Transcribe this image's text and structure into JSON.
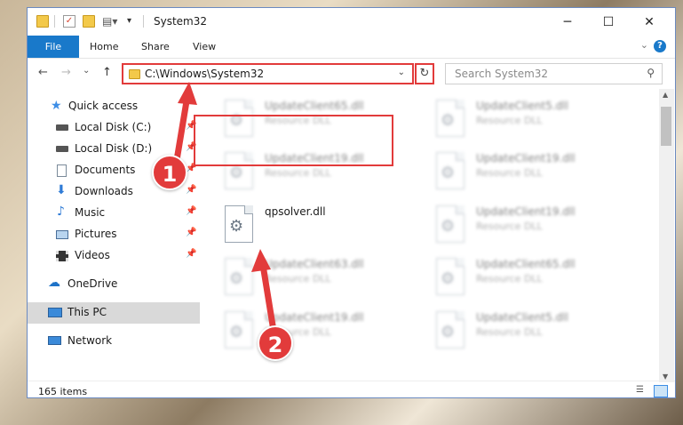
{
  "window": {
    "title": "System32",
    "controls": {
      "minimize": "─",
      "maximize": "☐",
      "close": "✕"
    }
  },
  "ribbon": {
    "tabs": [
      "File",
      "Home",
      "Share",
      "View"
    ],
    "help": "?"
  },
  "navbar": {
    "back": "←",
    "forward": "→",
    "dropdown": "⌄",
    "up": "↑",
    "address": "C:\\Windows\\System32",
    "address_dropdown": "⌄",
    "refresh": "↻",
    "search_placeholder": "Search System32"
  },
  "nav_pane": {
    "items": [
      {
        "label": "Quick access",
        "icon": "star-icon"
      },
      {
        "label": "Local Disk (C:)",
        "icon": "drive-icon",
        "pinned": true
      },
      {
        "label": "Local Disk (D:)",
        "icon": "drive-icon",
        "pinned": true
      },
      {
        "label": "Documents",
        "icon": "documents-icon",
        "pinned": true
      },
      {
        "label": "Downloads",
        "icon": "downloads-icon",
        "pinned": true
      },
      {
        "label": "Music",
        "icon": "music-icon",
        "pinned": true
      },
      {
        "label": "Pictures",
        "icon": "pictures-icon",
        "pinned": true
      },
      {
        "label": "Videos",
        "icon": "videos-icon",
        "pinned": true
      },
      {
        "label": "OneDrive",
        "icon": "onedrive-icon"
      },
      {
        "label": "This PC",
        "icon": "computer-icon",
        "selected": true
      },
      {
        "label": "Network",
        "icon": "network-icon"
      }
    ]
  },
  "files": [
    {
      "name": "UpdateClient65.dll",
      "type": "Resource DLL"
    },
    {
      "name": "UpdateClient5.dll",
      "type": "Resource DLL"
    },
    {
      "name": "UpdateClient19.dll",
      "type": "Resource DLL"
    },
    {
      "name": "UpdateClient19.dll",
      "type": "Resource DLL"
    },
    {
      "name": "qpsolver.dll",
      "type": ""
    },
    {
      "name": "UpdateClient19.dll",
      "type": "Resource DLL"
    },
    {
      "name": "UpdateClient63.dll",
      "type": "Resource DLL"
    },
    {
      "name": "UpdateClient65.dll",
      "type": "Resource DLL"
    },
    {
      "name": "UpdateClient19.dll",
      "type": "Resource DLL"
    },
    {
      "name": "UpdateClient5.dll",
      "type": "Resource DLL"
    }
  ],
  "status": {
    "items": "165 items"
  },
  "annotations": {
    "step1": "1",
    "step2": "2"
  },
  "colors": {
    "accent": "#1979ca",
    "highlight": "#e23b3b"
  }
}
